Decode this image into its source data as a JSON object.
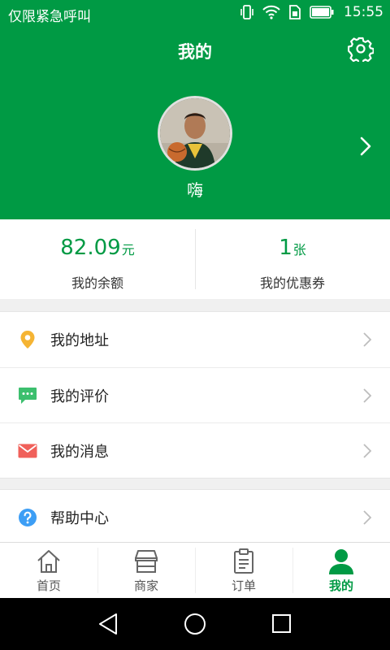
{
  "status_bar": {
    "carrier": "仅限紧急呼叫",
    "time": "15:55"
  },
  "header": {
    "title": "我的",
    "nickname": "嗨"
  },
  "stats": [
    {
      "value": "82.09",
      "unit": "元",
      "label": "我的余额"
    },
    {
      "value": "1",
      "unit": "张",
      "label": "我的优惠券"
    }
  ],
  "menu": {
    "group1": [
      {
        "label": "我的地址",
        "icon": "location-pin-icon",
        "color": "#f5b433"
      },
      {
        "label": "我的评价",
        "icon": "comment-icon",
        "color": "#3cbf6e"
      },
      {
        "label": "我的消息",
        "icon": "envelope-icon",
        "color": "#f0605a"
      }
    ],
    "group2": [
      {
        "label": "帮助中心",
        "icon": "help-icon",
        "color": "#3d9ef5"
      }
    ]
  },
  "tabs": [
    {
      "label": "首页",
      "icon": "home-icon"
    },
    {
      "label": "商家",
      "icon": "store-icon"
    },
    {
      "label": "订单",
      "icon": "clipboard-icon"
    },
    {
      "label": "我的",
      "icon": "person-icon",
      "active": true
    }
  ],
  "colors": {
    "brand": "#009a44",
    "background": "#f0f0f0"
  }
}
